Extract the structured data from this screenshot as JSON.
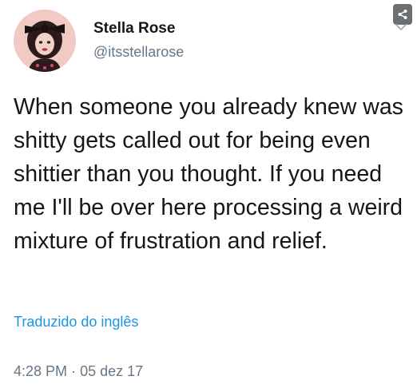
{
  "user": {
    "display_name": "Stella Rose",
    "handle": "@itsstellarose"
  },
  "tweet": {
    "text": "When someone you already knew was shitty gets called out for being even shittier than you thought. If you need me I'll be over here processing a weird mixture of frustration and relief.",
    "translate_label": "Traduzido do inglês",
    "time": "4:28 PM",
    "separator": "·",
    "date": "05 dez 17"
  },
  "icons": {
    "share": "share-icon",
    "menu": "chevron-down-icon"
  },
  "colors": {
    "text_primary": "#14171a",
    "text_secondary": "#657786",
    "link": "#1b95e0",
    "avatar_bg": "#f3c9c4",
    "share_button": "#6b6f72"
  }
}
